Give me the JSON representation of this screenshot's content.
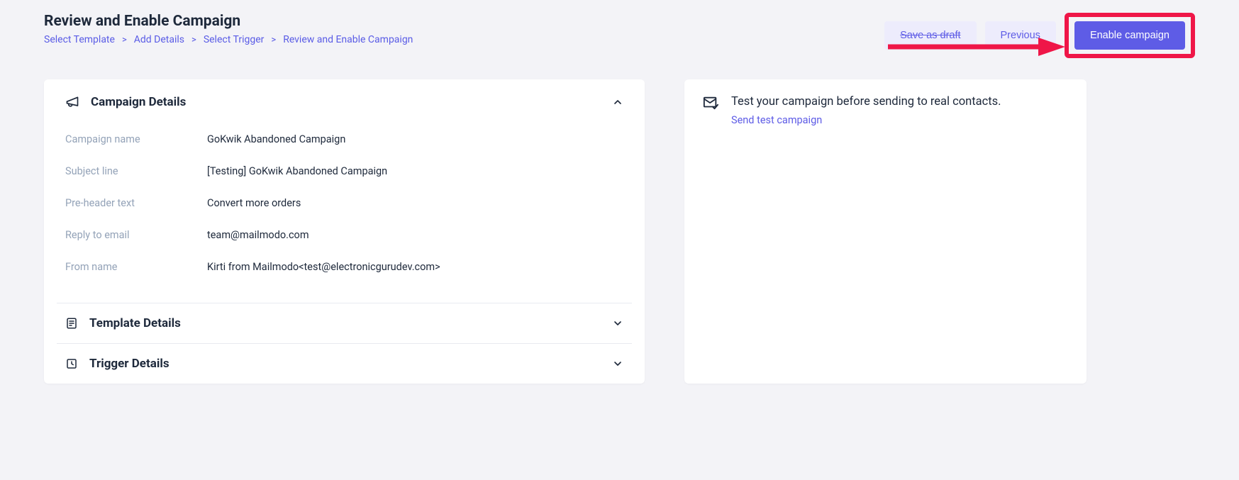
{
  "header": {
    "title": "Review and Enable Campaign",
    "breadcrumb": [
      "Select Template",
      "Add Details",
      "Select Trigger",
      "Review and Enable Campaign"
    ]
  },
  "actions": {
    "save_draft": "Save as draft",
    "previous": "Previous",
    "enable": "Enable campaign"
  },
  "campaign_details": {
    "section_title": "Campaign Details",
    "rows": [
      {
        "label": "Campaign name",
        "value": "GoKwik Abandoned Campaign"
      },
      {
        "label": "Subject line",
        "value": "[Testing] GoKwik Abandoned Campaign"
      },
      {
        "label": "Pre-header text",
        "value": "Convert more orders"
      },
      {
        "label": "Reply to email",
        "value": "team@mailmodo.com"
      },
      {
        "label": "From name",
        "value": "Kirti from Mailmodo<test@electronicgurudev.com>"
      }
    ]
  },
  "template_details": {
    "section_title": "Template Details"
  },
  "trigger_details": {
    "section_title": "Trigger Details"
  },
  "test_panel": {
    "text": "Test your campaign before sending to real contacts.",
    "link": "Send test campaign"
  }
}
